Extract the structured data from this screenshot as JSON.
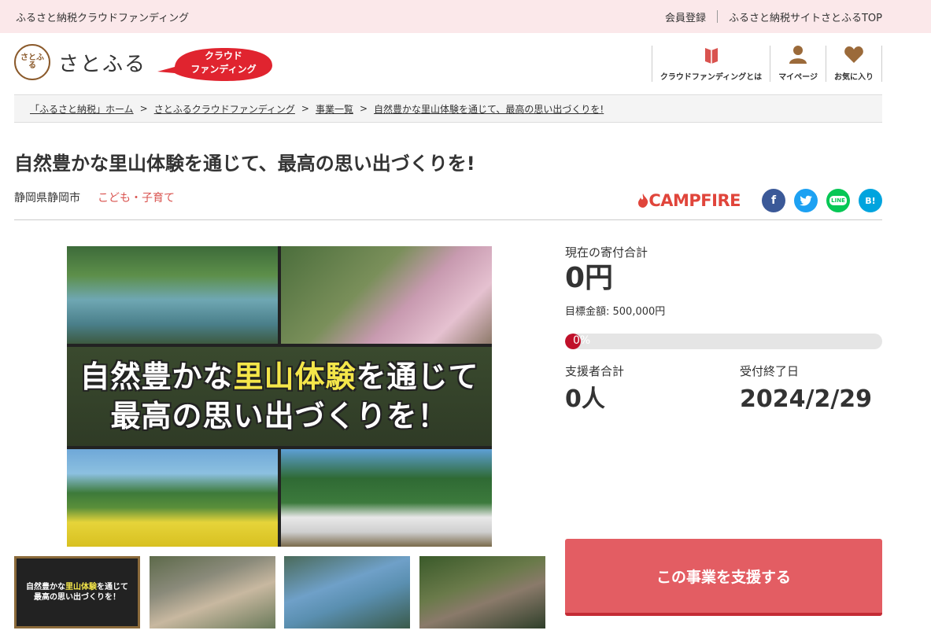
{
  "topbar": {
    "site_name": "ふるさと納税クラウドファンディング",
    "register": "会員登録",
    "top_link": "ふるさと納税サイトさとふるTOP"
  },
  "header": {
    "logo_mark": "さとふる",
    "logo_text": "さとふる",
    "badge_line1": "クラウド",
    "badge_line2": "ファンディング",
    "nav": [
      {
        "label": "クラウドファンディングとは",
        "icon": "book-icon"
      },
      {
        "label": "マイページ",
        "icon": "person-icon"
      },
      {
        "label": "お気に入り",
        "icon": "heart-icon"
      }
    ]
  },
  "breadcrumb": [
    "「ふるさと納税」ホーム",
    "さとふるクラウドファンディング",
    "事業一覧",
    "自然豊かな里山体験を通じて、最高の思い出づくりを!"
  ],
  "project": {
    "title": "自然豊かな里山体験を通じて、最高の思い出づくりを!",
    "prefecture": "静岡県静岡市",
    "category": "こども・子育て",
    "partner": "CAMPFIRE",
    "image_line1_a": "自然豊かな",
    "image_line1_hl": "里山体験",
    "image_line1_b": "を通じて",
    "image_line2": "最高の思い出づくりを！"
  },
  "share": {
    "facebook": "f",
    "twitter": "t",
    "line": "LINE",
    "hatena": "B!"
  },
  "stats": {
    "total_label": "現在の寄付合計",
    "total_value": "0円",
    "target_label": "目標金額: 500,000円",
    "progress_text": "0%",
    "progress_fraction": 0,
    "supporters_label": "支援者合計",
    "supporters_value": "0人",
    "deadline_label": "受付終了日",
    "deadline_value": "2024/2/29"
  },
  "cta": {
    "label": "この事業を支援する"
  },
  "colors": {
    "accent": "#e35d63",
    "category": "#d9534f",
    "campfire": "#e0453b",
    "topbar": "#fbe8ea"
  }
}
